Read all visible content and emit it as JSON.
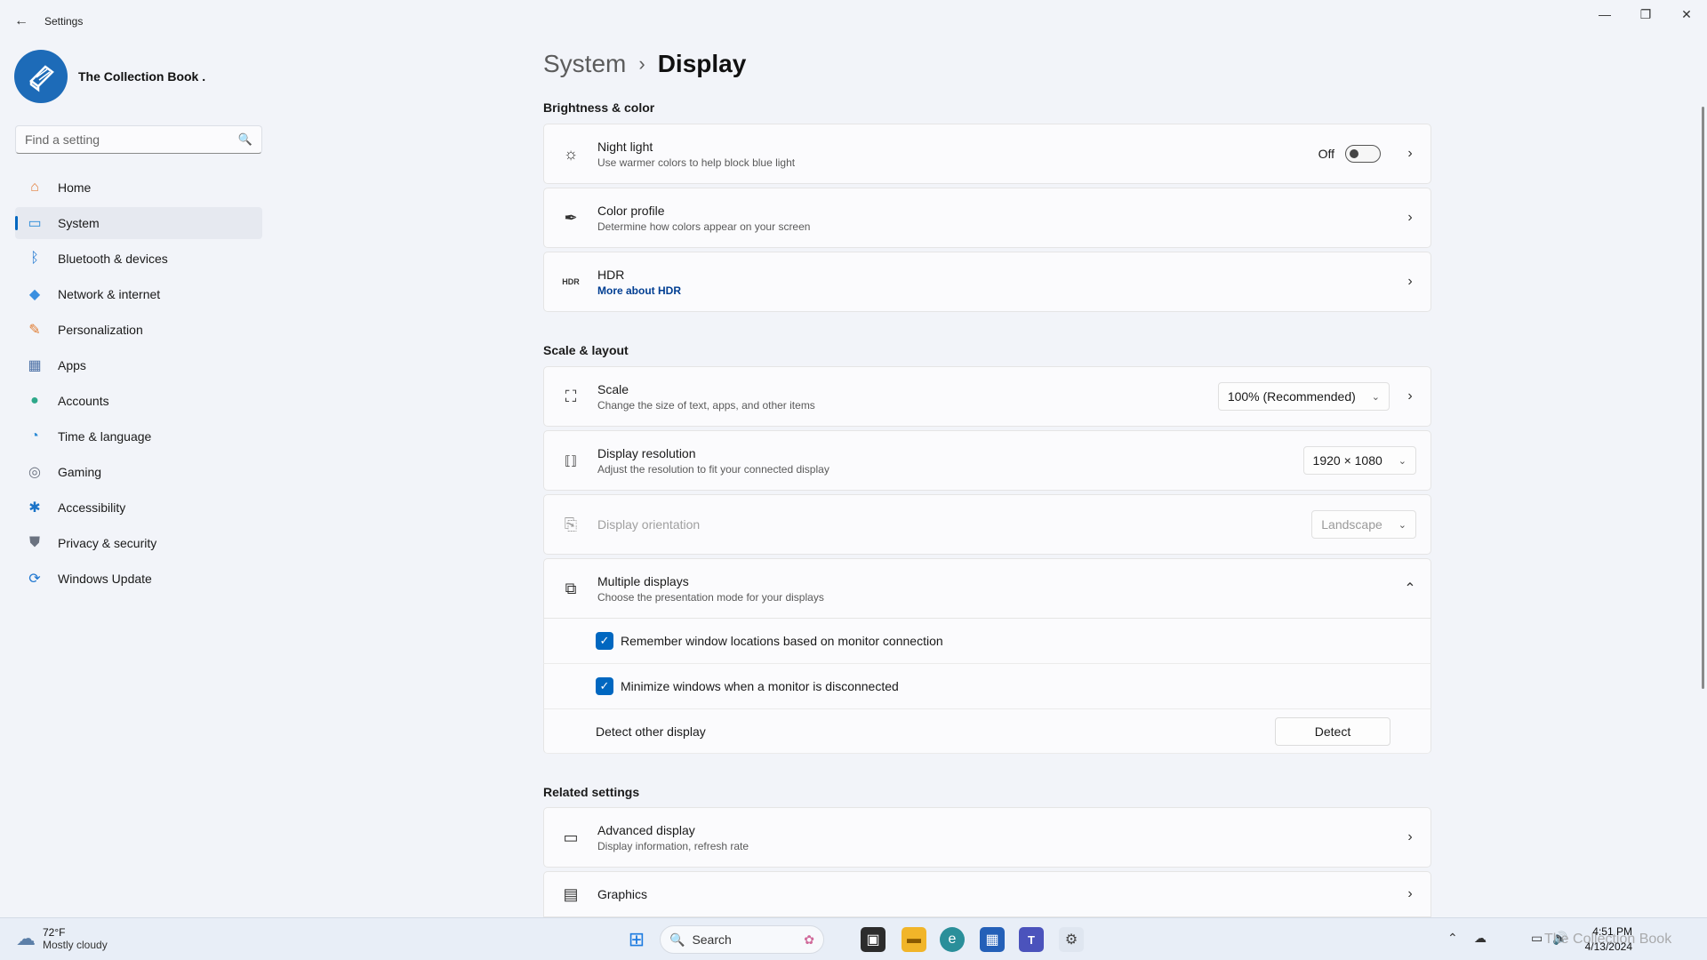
{
  "window": {
    "app_title": "Settings",
    "back_icon": "←",
    "minimize_icon": "—",
    "restore_icon": "❐",
    "close_icon": "✕"
  },
  "profile": {
    "name": "The Collection Book ."
  },
  "search": {
    "placeholder": "Find a setting",
    "icon": "🔍"
  },
  "sidebar": {
    "items": [
      {
        "label": "Home",
        "icon": "⌂",
        "color": "#e27d3a"
      },
      {
        "label": "System",
        "icon": "▭",
        "color": "#2a8bd8",
        "active": true
      },
      {
        "label": "Bluetooth & devices",
        "icon": "ᛒ",
        "color": "#1e76d0"
      },
      {
        "label": "Network & internet",
        "icon": "◆",
        "color": "#3a8fe0"
      },
      {
        "label": "Personalization",
        "icon": "✎",
        "color": "#e07a2e"
      },
      {
        "label": "Apps",
        "icon": "▦",
        "color": "#4a6fa5"
      },
      {
        "label": "Accounts",
        "icon": "●",
        "color": "#2ea88a"
      },
      {
        "label": "Time & language",
        "icon": "◔",
        "color": "#2e8bd6"
      },
      {
        "label": "Gaming",
        "icon": "◎",
        "color": "#6b7280"
      },
      {
        "label": "Accessibility",
        "icon": "✱",
        "color": "#1a73c8"
      },
      {
        "label": "Privacy & security",
        "icon": "⛊",
        "color": "#6b7280"
      },
      {
        "label": "Windows Update",
        "icon": "⟳",
        "color": "#1e76d0"
      }
    ]
  },
  "breadcrumb": {
    "parent": "System",
    "separator": "›",
    "current": "Display"
  },
  "sections": {
    "brightness": "Brightness & color",
    "scale": "Scale & layout",
    "related": "Related settings"
  },
  "night_light": {
    "title": "Night light",
    "subtitle": "Use warmer colors to help block blue light",
    "state": "Off",
    "icon": "☼"
  },
  "color_profile": {
    "title": "Color profile",
    "subtitle": "Determine how colors appear on your screen",
    "icon": "✒"
  },
  "hdr": {
    "title": "HDR",
    "link": "More about HDR",
    "icon": "HDR"
  },
  "scale_row": {
    "title": "Scale",
    "subtitle": "Change the size of text, apps, and other items",
    "value": "100% (Recommended)",
    "icon": "⛶"
  },
  "resolution": {
    "title": "Display resolution",
    "subtitle": "Adjust the resolution to fit your connected display",
    "value": "1920 × 1080",
    "icon": "⟦⟧"
  },
  "orientation": {
    "title": "Display orientation",
    "value": "Landscape",
    "icon": "⎘"
  },
  "multiple": {
    "title": "Multiple displays",
    "subtitle": "Choose the presentation mode for your displays",
    "icon": "⧉",
    "expand_icon": "⌃",
    "remember": "Remember window locations based on monitor connection",
    "minimize": "Minimize windows when a monitor is disconnected",
    "detect_label": "Detect other display",
    "detect_button": "Detect"
  },
  "advanced": {
    "title": "Advanced display",
    "subtitle": "Display information, refresh rate",
    "icon": "▭"
  },
  "graphics": {
    "title": "Graphics",
    "icon": "▤"
  },
  "chevron": "›",
  "dropdown_arrow": "⌄",
  "checkmark": "✓",
  "taskbar": {
    "temp": "72°F",
    "weather": "Mostly cloudy",
    "search": "Search",
    "time": "4:51 PM",
    "date": "4/13/2024",
    "watermark": "The Collection Book"
  }
}
